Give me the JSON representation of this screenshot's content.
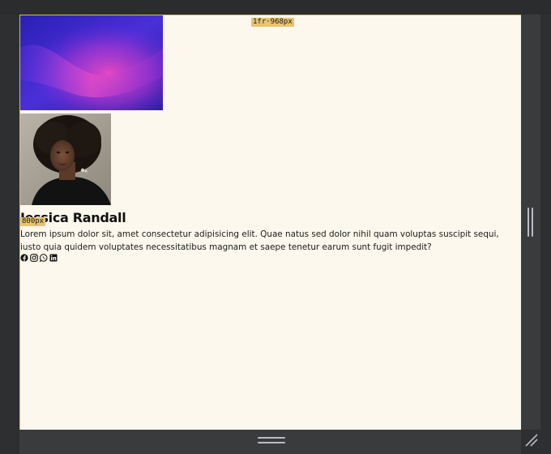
{
  "profile": {
    "name": "Jessica Randall",
    "bio": "Lorem ipsum dolor sit, amet consectetur adipisicing elit. Quae natus sed dolor nihil quam voluptas suscipit sequi, iusto quia quidem voluptates necessitatibus magnam et saepe tenetur earum sunt fugit impedit?",
    "socials": [
      "facebook-icon",
      "instagram-icon",
      "whatsapp-icon",
      "linkedin-icon"
    ]
  },
  "overlay": {
    "column_track_label": "1fr·968px",
    "row_track_label": "800px"
  },
  "colors": {
    "page_background": "#fdf8ee",
    "frame_background": "#2e2f31",
    "overlay_badge": "#e9c46a",
    "banner_primary": "#3b2bd6",
    "banner_accent": "#e23bb8"
  }
}
